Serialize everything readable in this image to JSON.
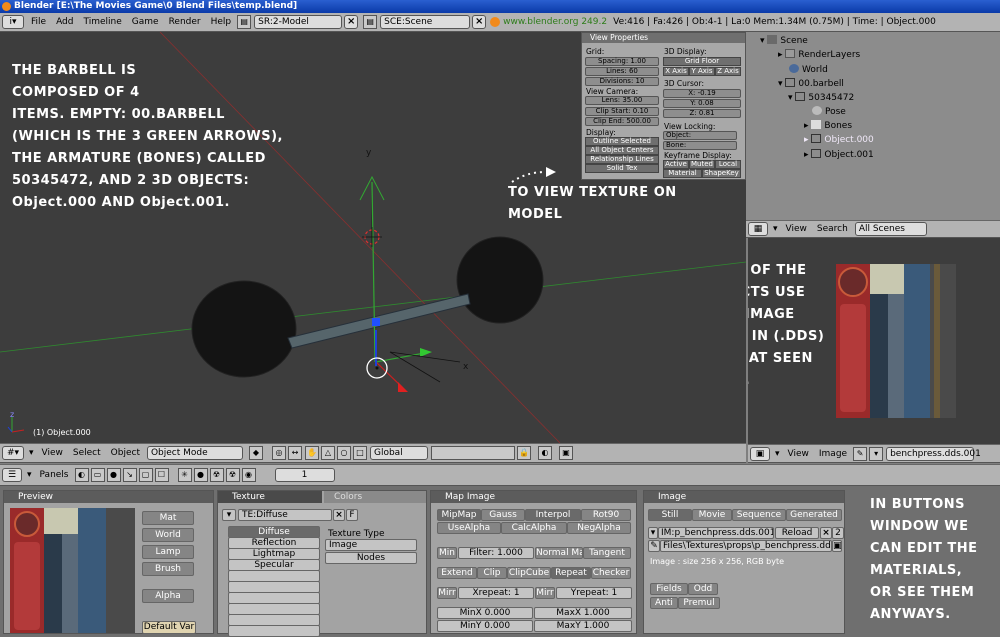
{
  "window": {
    "title": "Blender [E:\\The Movies Game\\0 Blend Files\\temp.blend]"
  },
  "info_header": {
    "menus": [
      "File",
      "Add",
      "Timeline",
      "Game",
      "Render",
      "Help"
    ],
    "screen": "SR:2-Model",
    "scene": "SCE:Scene",
    "url": "www.blender.org 249.2",
    "stats": "Ve:416 | Fa:426 | Ob:4-1 | La:0  Mem:1.34M (0.75M) | Time: | Object.000"
  },
  "viewport": {
    "annotation_main": "THE BARBELL IS\nCOMPOSED OF 4\nITEMS. EMPTY: 00.BARBELL\n(WHICH IS THE 3 GREEN ARROWS),\nTHE ARMATURE (BONES) CALLED\n50345472, AND 2 3D OBJECTS:\nObject.000 AND Object.001.",
    "annotation_texture": "TO VIEW TEXTURE ON\nMODEL",
    "annotation_images": "EACH OF THE\nOBJECTS USE\nTWO IMAGE\nFILES IN (.DDS)\nFORMAT SEEN\nHERE.",
    "object_label": "(1) Object.000",
    "axis_y": "y",
    "axis_x": "x",
    "axis_z": "z"
  },
  "view_properties": {
    "title": "View Properties",
    "grid_label": "Grid:",
    "spacing": "Spacing: 1.00",
    "lines": "Lines: 60",
    "divisions": "Divisions: 10",
    "view_camera_label": "View Camera:",
    "lens": "Lens: 35.00",
    "clip_start": "Clip Start: 0.10",
    "clip_end": "Clip End: 500.00",
    "display_label": "Display:",
    "outline_selected": "Outline Selected",
    "all_object_centers": "All Object Centers",
    "relationship_lines": "Relationship Lines",
    "solid_tex": "Solid Tex",
    "display3d_label": "3D Display:",
    "grid_floor": "Grid Floor",
    "x_axis": "X Axis",
    "y_axis": "Y Axis",
    "z_axis": "Z Axis",
    "cursor_label": "3D Cursor:",
    "cx": "X: -0.19",
    "cy": "Y: 0.08",
    "cz": "Z: 0.81",
    "view_locking_label": "View Locking:",
    "object_lock": "Object:",
    "bone_lock": "Bone:",
    "keyframe_label": "Keyframe Display:",
    "active": "Active",
    "muted": "Muted",
    "local": "Local",
    "material": "Material",
    "shapekey": "ShapeKey"
  },
  "outliner": {
    "items": [
      {
        "label": "Scene"
      },
      {
        "label": "RenderLayers"
      },
      {
        "label": "World"
      },
      {
        "label": "00.barbell"
      },
      {
        "label": "50345472"
      },
      {
        "label": "Pose"
      },
      {
        "label": "Bones"
      },
      {
        "label": "Object.000"
      },
      {
        "label": "Object.001"
      }
    ],
    "header_view": "View",
    "header_search": "Search",
    "header_scenes": "All Scenes"
  },
  "viewport_header": {
    "view": "View",
    "select": "Select",
    "object": "Object",
    "mode": "Object Mode",
    "orientation": "Global"
  },
  "image_header": {
    "view": "View",
    "image": "Image",
    "image_name": "benchpress.dds.001"
  },
  "buttons_header": {
    "panels": "Panels",
    "frame": "1"
  },
  "preview": {
    "title": "Preview",
    "mat": "Mat",
    "world": "World",
    "lamp": "Lamp",
    "brush": "Brush",
    "alpha": "Alpha",
    "default_var": "Default Var"
  },
  "texture": {
    "tab_texture": "Texture",
    "tab_colors": "Colors",
    "te_name": "TE:Diffuse",
    "slots": [
      "Diffuse",
      "Reflection",
      "Lightmap",
      "Specular",
      "",
      "",
      "",
      "",
      "",
      ""
    ],
    "texture_type_label": "Texture Type",
    "texture_type": "Image",
    "nodes": "Nodes"
  },
  "map_image": {
    "title": "Map Image",
    "mipmap": "MipMap",
    "gauss": "Gauss",
    "interpol": "Interpol",
    "rot90": "Rot90",
    "usealpha": "UseAlpha",
    "calcalpha": "CalcAlpha",
    "negalpha": "NegAlpha",
    "min": "Min",
    "filter": "Filter: 1.000",
    "normal_map": "Normal Ma",
    "tangent": "Tangent",
    "extend": "Extend",
    "clip": "Clip",
    "clipcube": "ClipCube",
    "repeat": "Repeat",
    "checker": "Checker",
    "mirr_x": "Mirr",
    "xrepeat": "Xrepeat: 1",
    "mirr_y": "Mirr",
    "yrepeat": "Yrepeat: 1",
    "minx": "MinX 0.000",
    "maxx": "MaxX 1.000",
    "miny": "MinY 0.000",
    "maxy": "MaxY 1.000"
  },
  "image_panel": {
    "title": "Image",
    "still": "Still",
    "movie": "Movie",
    "sequence": "Sequence",
    "generated": "Generated",
    "im_name": "IM:p_benchpress.dds.001",
    "reload": "Reload",
    "users": "2",
    "path": "Files\\Textures\\props\\p_benchpress.dds",
    "size_info": "Image : size 256 x 256, RGB byte",
    "fields": "Fields",
    "odd": "Odd",
    "anti": "Anti",
    "premul": "Premul"
  },
  "buttons_annotation": "IN BUTTONS\nWINDOW WE\nCAN EDIT THE\nMATERIALS,\nOR SEE THEM\nANYWAYS."
}
